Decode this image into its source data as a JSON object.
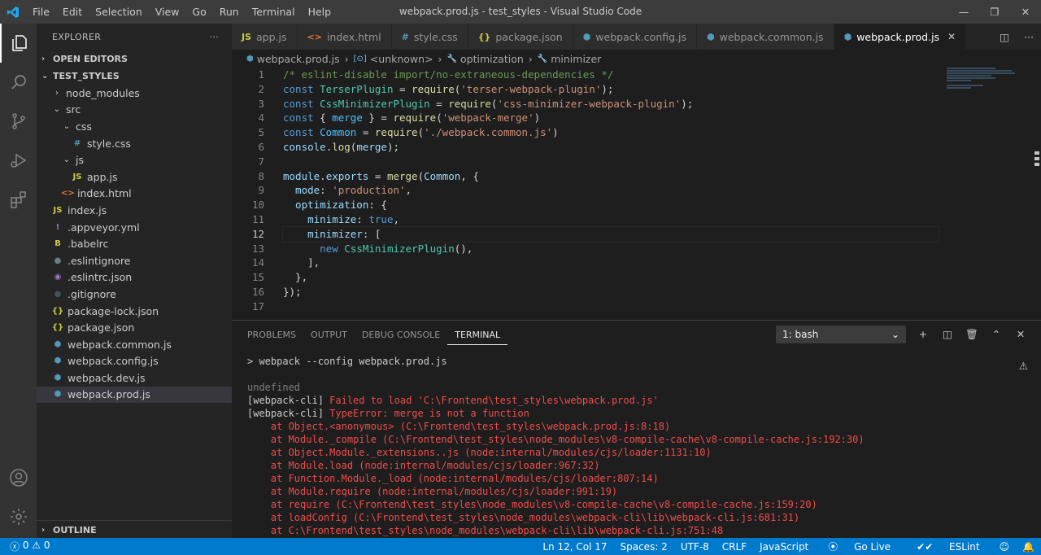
{
  "titlebar": {
    "menu": [
      "File",
      "Edit",
      "Selection",
      "View",
      "Go",
      "Run",
      "Terminal",
      "Help"
    ],
    "window_title": "webpack.prod.js - test_styles - Visual Studio Code",
    "minimize": "—",
    "restore": "❐",
    "close": "✕"
  },
  "sidebar": {
    "title": "EXPLORER",
    "more": "···",
    "open_editors": "OPEN EDITORS",
    "project": "TEST_STYLES",
    "outline": "OUTLINE",
    "tree": [
      {
        "label": "node_modules",
        "twisty": "›",
        "icon": "",
        "icon_color": "#cccccc"
      },
      {
        "label": "src",
        "twisty": "⌄",
        "icon": "",
        "icon_color": "#cccccc"
      },
      {
        "label": "css",
        "twisty": "⌄",
        "icon": "",
        "icon_color": "#cccccc"
      },
      {
        "label": "style.css",
        "twisty": "",
        "icon": "#",
        "icon_color": "#519aba"
      },
      {
        "label": "js",
        "twisty": "⌄",
        "icon": "",
        "icon_color": "#cccccc"
      },
      {
        "label": "app.js",
        "twisty": "",
        "icon": "JS",
        "icon_color": "#cbcb41"
      },
      {
        "label": "index.html",
        "twisty": "",
        "icon": "<>",
        "icon_color": "#e37933"
      },
      {
        "label": "index.js",
        "twisty": "",
        "icon": "JS",
        "icon_color": "#cbcb41"
      },
      {
        "label": ".appveyor.yml",
        "twisty": "",
        "icon": "!",
        "icon_color": "#a074c4"
      },
      {
        "label": ".babelrc",
        "twisty": "",
        "icon": "B",
        "icon_color": "#cbcb41"
      },
      {
        "label": ".eslintignore",
        "twisty": "",
        "icon": "●",
        "icon_color": "#6d8086"
      },
      {
        "label": ".eslintrc.json",
        "twisty": "",
        "icon": "◉",
        "icon_color": "#a074c4"
      },
      {
        "label": ".gitignore",
        "twisty": "",
        "icon": "●",
        "icon_color": "#41535b"
      },
      {
        "label": "package-lock.json",
        "twisty": "",
        "icon": "{}",
        "icon_color": "#cbcb41"
      },
      {
        "label": "package.json",
        "twisty": "",
        "icon": "{}",
        "icon_color": "#cbcb41"
      },
      {
        "label": "webpack.common.js",
        "twisty": "",
        "icon": "⬢",
        "icon_color": "#519aba"
      },
      {
        "label": "webpack.config.js",
        "twisty": "",
        "icon": "⬢",
        "icon_color": "#519aba"
      },
      {
        "label": "webpack.dev.js",
        "twisty": "",
        "icon": "⬢",
        "icon_color": "#519aba"
      },
      {
        "label": "webpack.prod.js",
        "twisty": "",
        "icon": "⬢",
        "icon_color": "#519aba"
      }
    ]
  },
  "tabs": [
    {
      "label": "app.js",
      "icon": "JS",
      "icon_color": "#cbcb41"
    },
    {
      "label": "index.html",
      "icon": "<>",
      "icon_color": "#e37933"
    },
    {
      "label": "style.css",
      "icon": "#",
      "icon_color": "#519aba"
    },
    {
      "label": "package.json",
      "icon": "{}",
      "icon_color": "#cbcb41"
    },
    {
      "label": "webpack.config.js",
      "icon": "⬢",
      "icon_color": "#519aba"
    },
    {
      "label": "webpack.common.js",
      "icon": "⬢",
      "icon_color": "#519aba"
    },
    {
      "label": "webpack.prod.js",
      "icon": "⬢",
      "icon_color": "#519aba",
      "close": "✕"
    }
  ],
  "breadcrumb": {
    "file": "webpack.prod.js",
    "s1": "<unknown>",
    "s2": "optimization",
    "s3": "minimizer",
    "sep": "›"
  },
  "editor": {
    "line_numbers": [
      "1",
      "2",
      "3",
      "4",
      "5",
      "6",
      "7",
      "8",
      "9",
      "10",
      "11",
      "12",
      "13",
      "14",
      "15",
      "16",
      "17"
    ],
    "lines": [
      [
        {
          "t": "/* eslint-disable import/no-extraneous-dependencies */",
          "c": "c-com"
        }
      ],
      [
        {
          "t": "const ",
          "c": "c-kw"
        },
        {
          "t": "TerserPlugin",
          "c": "c-cls"
        },
        {
          "t": " = ",
          "c": ""
        },
        {
          "t": "require",
          "c": "c-fn"
        },
        {
          "t": "(",
          "c": ""
        },
        {
          "t": "'terser-webpack-plugin'",
          "c": "c-str"
        },
        {
          "t": ");",
          "c": ""
        }
      ],
      [
        {
          "t": "const ",
          "c": "c-kw"
        },
        {
          "t": "CssMinimizerPlugin",
          "c": "c-cls"
        },
        {
          "t": " = ",
          "c": ""
        },
        {
          "t": "require",
          "c": "c-fn"
        },
        {
          "t": "(",
          "c": ""
        },
        {
          "t": "'css-minimizer-webpack-plugin'",
          "c": "c-str"
        },
        {
          "t": ");",
          "c": ""
        }
      ],
      [
        {
          "t": "const ",
          "c": "c-kw"
        },
        {
          "t": "{ ",
          "c": ""
        },
        {
          "t": "merge",
          "c": "c-cst"
        },
        {
          "t": " } = ",
          "c": ""
        },
        {
          "t": "require",
          "c": "c-fn"
        },
        {
          "t": "(",
          "c": ""
        },
        {
          "t": "'webpack-merge'",
          "c": "c-str"
        },
        {
          "t": ")",
          "c": ""
        }
      ],
      [
        {
          "t": "const ",
          "c": "c-kw"
        },
        {
          "t": "Common",
          "c": "c-cst"
        },
        {
          "t": " = ",
          "c": ""
        },
        {
          "t": "require",
          "c": "c-fn"
        },
        {
          "t": "(",
          "c": ""
        },
        {
          "t": "'./webpack.common.js'",
          "c": "c-str"
        },
        {
          "t": ")",
          "c": ""
        }
      ],
      [
        {
          "t": "console",
          "c": "c-var"
        },
        {
          "t": ".",
          "c": ""
        },
        {
          "t": "log",
          "c": "c-fn"
        },
        {
          "t": "(",
          "c": ""
        },
        {
          "t": "merge",
          "c": "c-var"
        },
        {
          "t": ");",
          "c": ""
        }
      ],
      [
        {
          "t": "",
          "c": ""
        }
      ],
      [
        {
          "t": "module",
          "c": "c-var"
        },
        {
          "t": ".",
          "c": ""
        },
        {
          "t": "exports",
          "c": "c-var"
        },
        {
          "t": " = ",
          "c": ""
        },
        {
          "t": "merge",
          "c": "c-fn"
        },
        {
          "t": "(",
          "c": ""
        },
        {
          "t": "Common",
          "c": "c-var"
        },
        {
          "t": ", {",
          "c": ""
        }
      ],
      [
        {
          "t": "  mode",
          "c": "c-var"
        },
        {
          "t": ": ",
          "c": ""
        },
        {
          "t": "'production'",
          "c": "c-str"
        },
        {
          "t": ",",
          "c": ""
        }
      ],
      [
        {
          "t": "  optimization",
          "c": "c-var"
        },
        {
          "t": ": {",
          "c": ""
        }
      ],
      [
        {
          "t": "    minimize",
          "c": "c-var"
        },
        {
          "t": ": ",
          "c": ""
        },
        {
          "t": "true",
          "c": "c-kw"
        },
        {
          "t": ",",
          "c": ""
        }
      ],
      [
        {
          "t": "    minimizer",
          "c": "c-var"
        },
        {
          "t": ": [",
          "c": ""
        }
      ],
      [
        {
          "t": "      new ",
          "c": "c-kw"
        },
        {
          "t": "CssMinimizerPlugin",
          "c": "c-cls"
        },
        {
          "t": "(),",
          "c": ""
        }
      ],
      [
        {
          "t": "    ],",
          "c": ""
        }
      ],
      [
        {
          "t": "  },",
          "c": ""
        }
      ],
      [
        {
          "t": "});",
          "c": ""
        }
      ],
      [
        {
          "t": "",
          "c": ""
        }
      ]
    ],
    "current_line": 12
  },
  "panel": {
    "tabs": [
      "PROBLEMS",
      "OUTPUT",
      "DEBUG CONSOLE",
      "TERMINAL"
    ],
    "active_tab": "TERMINAL",
    "terminal_select": "1: bash",
    "select_chevron": "⌄",
    "actions": {
      "add": "+",
      "split": "◫",
      "trash": "🗑",
      "maximize": "⌃",
      "close": "✕"
    },
    "warning": "⚠",
    "lines": [
      {
        "t": "> webpack --config webpack.prod.js",
        "c": "t-white"
      },
      {
        "t": "",
        "c": "t-white"
      },
      {
        "t": "undefined",
        "c": "t-gray"
      },
      {
        "t": "[webpack-cli] |Failed to load 'C:\\Frontend\\test_styles\\webpack.prod.js'",
        "c": "mix"
      },
      {
        "t": "[webpack-cli] |TypeError: merge is not a function",
        "c": "mix"
      },
      {
        "t": "    at Object.<anonymous> (C:\\Frontend\\test_styles\\webpack.prod.js:8:18)",
        "c": "t-red"
      },
      {
        "t": "    at Module._compile (C:\\Frontend\\test_styles\\node_modules\\v8-compile-cache\\v8-compile-cache.js:192:30)",
        "c": "t-red"
      },
      {
        "t": "    at Object.Module._extensions..js (node:internal/modules/cjs/loader:1131:10)",
        "c": "t-red"
      },
      {
        "t": "    at Module.load (node:internal/modules/cjs/loader:967:32)",
        "c": "t-red"
      },
      {
        "t": "    at Function.Module._load (node:internal/modules/cjs/loader:807:14)",
        "c": "t-red"
      },
      {
        "t": "    at Module.require (node:internal/modules/cjs/loader:991:19)",
        "c": "t-red"
      },
      {
        "t": "    at require (C:\\Frontend\\test_styles\\node_modules\\v8-compile-cache\\v8-compile-cache.js:159:20)",
        "c": "t-red"
      },
      {
        "t": "    at loadConfig (C:\\Frontend\\test_styles\\node_modules\\webpack-cli\\lib\\webpack-cli.js:681:31)",
        "c": "t-red"
      },
      {
        "t": "    at C:\\Frontend\\test_styles\\node_modules\\webpack-cli\\lib\\webpack-cli.js:751:48",
        "c": "t-red"
      }
    ]
  },
  "statusbar": {
    "errors": "0",
    "warnings": "0",
    "position": "Ln 12, Col 17",
    "spaces": "Spaces: 2",
    "encoding": "UTF-8",
    "eol": "CRLF",
    "language": "JavaScript",
    "golive": "Go Live",
    "eslint": "ESLint"
  },
  "colors": {
    "accent": "#007acc",
    "error_text": "#f14c4c"
  }
}
